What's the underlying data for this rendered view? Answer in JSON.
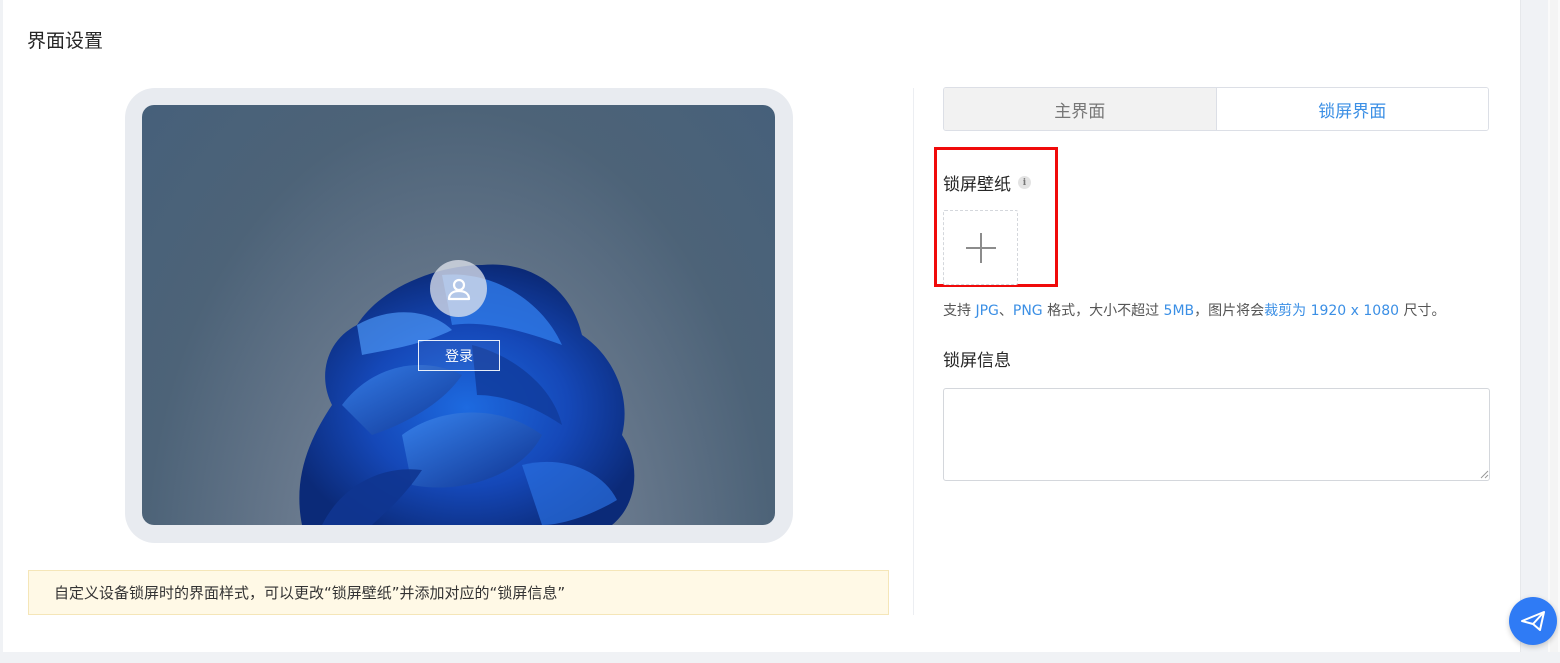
{
  "page": {
    "title": "界面设置"
  },
  "preview": {
    "login_label": "登录",
    "avatar_icon": "user-icon"
  },
  "notice": {
    "text": "自定义设备锁屏时的界面样式，可以更改“锁屏壁纸”并添加对应的“锁屏信息”"
  },
  "tabs": [
    {
      "label": "主界面",
      "active": false
    },
    {
      "label": "锁屏界面",
      "active": true
    }
  ],
  "wallpaper": {
    "label": "锁屏壁纸",
    "info_icon": "i",
    "upload_icon": "plus-icon",
    "hint": {
      "prefix": "支持 ",
      "jpg": "JPG",
      "sep": "、",
      "png": "PNG",
      "mid1": " 格式，大小不超过 ",
      "size": "5MB",
      "mid2": "，图片将会",
      "crop": "裁剪为 1920 x 1080",
      "suffix": " 尺寸。"
    }
  },
  "lock_info": {
    "label": "锁屏信息",
    "value": ""
  },
  "colors": {
    "accent": "#3b8fe5",
    "highlight": "#f00a0a",
    "notice_bg": "#fff9e6",
    "fab": "#2f7bf5"
  }
}
